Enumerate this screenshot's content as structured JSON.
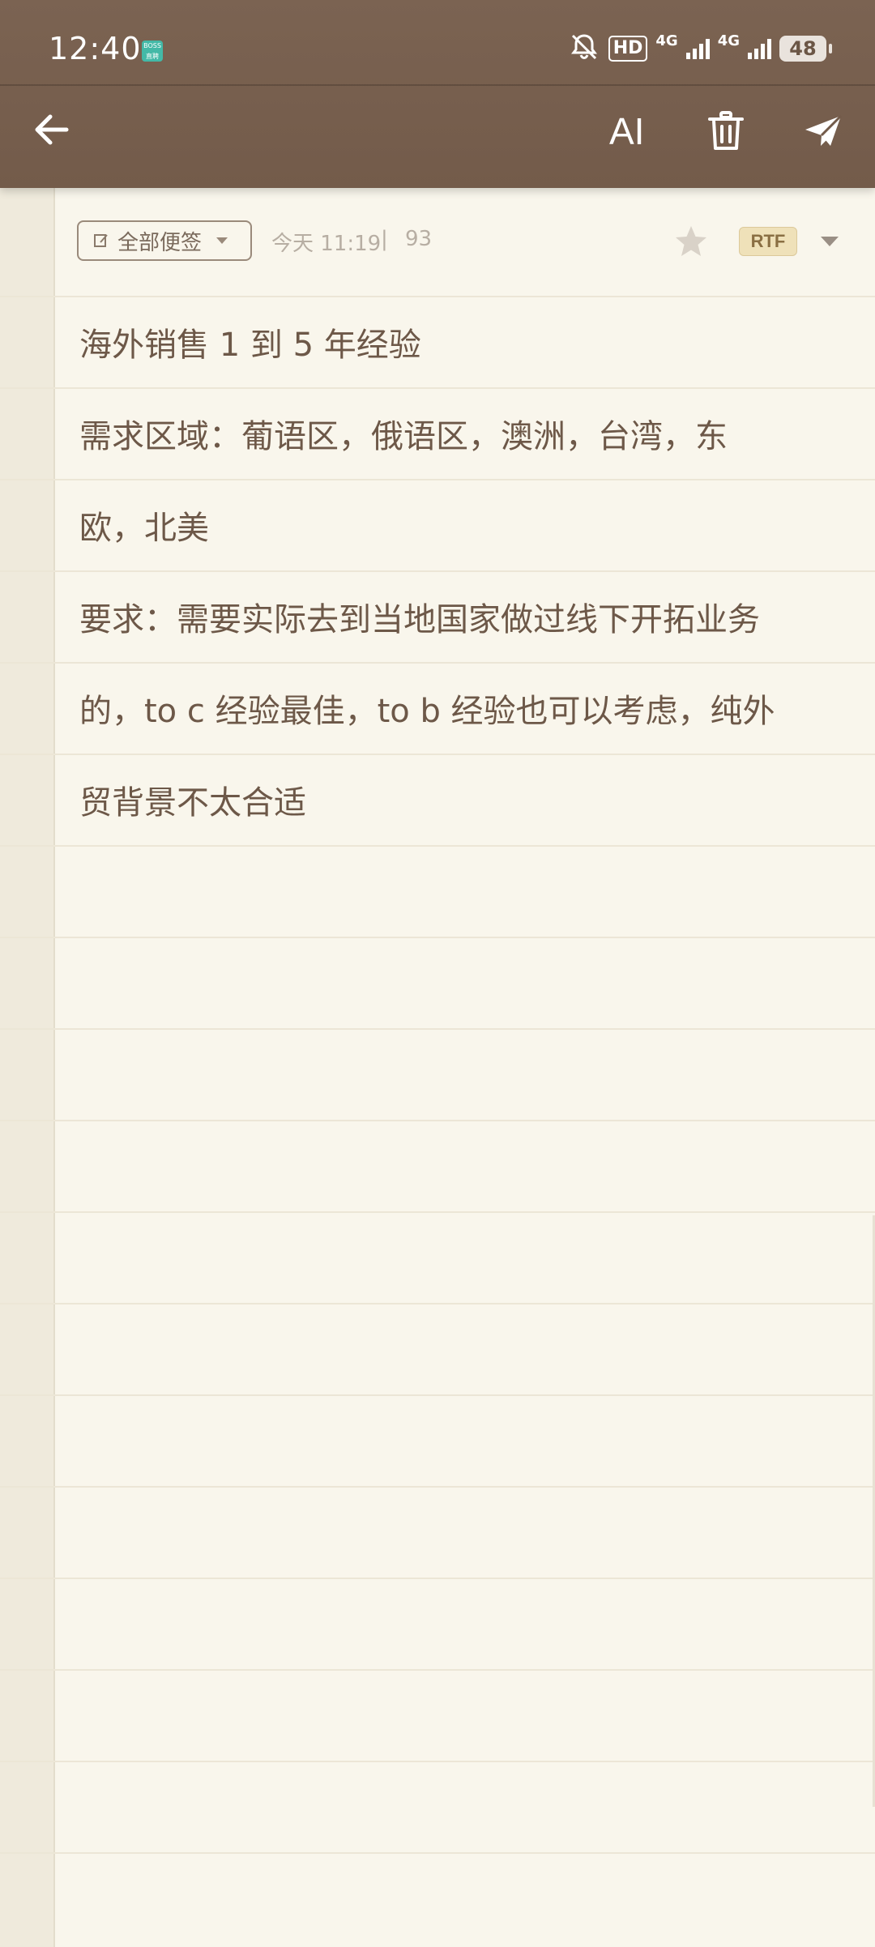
{
  "status_bar": {
    "time": "12:40",
    "app_badge": "BOSS直聘",
    "hd_label": "HD",
    "net1": "4G",
    "net2": "4G",
    "battery": "48"
  },
  "toolbar": {
    "back_icon": "arrow-left-icon",
    "ai_label": "AI",
    "delete_icon": "trash-icon",
    "send_icon": "paper-plane-icon"
  },
  "meta": {
    "category": "全部便签",
    "time": "今天 11:19",
    "separator": "|",
    "count": "93",
    "star_icon": "star-icon",
    "format_badge": "RTF"
  },
  "note": {
    "lines": [
      "海外销售 1 到 5 年经验",
      "需求区域：葡语区，俄语区，澳洲，台湾，东",
      "欧，北美",
      "要求：需要实际去到当地国家做过线下开拓业务",
      "的，to c 经验最佳，to b 经验也可以考虑，纯外",
      "贸背景不太合适"
    ]
  },
  "colors": {
    "toolbar_bg": "#735b4a",
    "paper_bg": "#f9f6ec",
    "text": "#6d5848",
    "meta_text": "#b7aea3",
    "rtf_bg": "#efe1b9"
  }
}
